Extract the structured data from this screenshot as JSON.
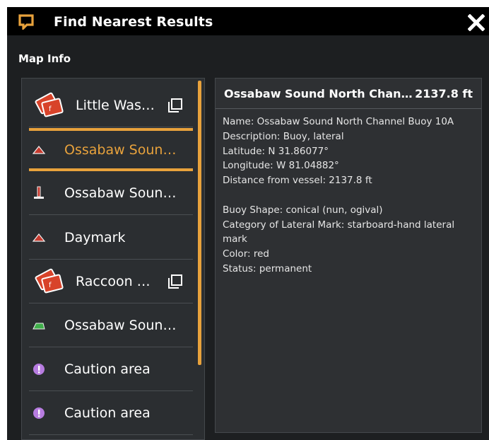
{
  "window": {
    "title": "Find Nearest Results",
    "close_label": "X",
    "app_icon": "chat-bubble-icon"
  },
  "section": {
    "label": "Map Info"
  },
  "list": {
    "items": [
      {
        "label": "Little Was…",
        "icon": "card-stack-icon",
        "selected": false,
        "multi": true
      },
      {
        "label": "Ossabaw Soun…",
        "icon": "red-triangle-icon",
        "selected": true,
        "multi": false
      },
      {
        "label": "Ossabaw Soun…",
        "icon": "red-marker-icon",
        "selected": false,
        "multi": false
      },
      {
        "label": "Daymark",
        "icon": "red-triangle-icon",
        "selected": false,
        "multi": false
      },
      {
        "label": "Raccoon …",
        "icon": "card-stack-icon",
        "selected": false,
        "multi": true
      },
      {
        "label": "Ossabaw Soun…",
        "icon": "green-buoy-icon",
        "selected": false,
        "multi": false
      },
      {
        "label": "Caution area",
        "icon": "caution-icon",
        "selected": false,
        "multi": false
      },
      {
        "label": "Caution area",
        "icon": "caution-icon",
        "selected": false,
        "multi": false
      }
    ]
  },
  "detail": {
    "title": "Ossabaw Sound North Chan…",
    "distance": "2137.8 ft",
    "lines": [
      "Name: Ossabaw Sound North Channel Buoy 10A",
      "Description: Buoy, lateral",
      "Latitude: N 31.86077°",
      "Longitude: W 81.04882°",
      "Distance from vessel: 2137.8 ft",
      "",
      "Buoy Shape: conical (nun, ogival)",
      "Category of Lateral Mark: starboard-hand lateral",
      "mark",
      "Color: red",
      "Status: permanent"
    ]
  },
  "colors": {
    "accent": "#e8a23c",
    "window_bg": "#1d1f21",
    "titlebar_bg": "#000000",
    "panel_bg": "#2b2e31"
  }
}
